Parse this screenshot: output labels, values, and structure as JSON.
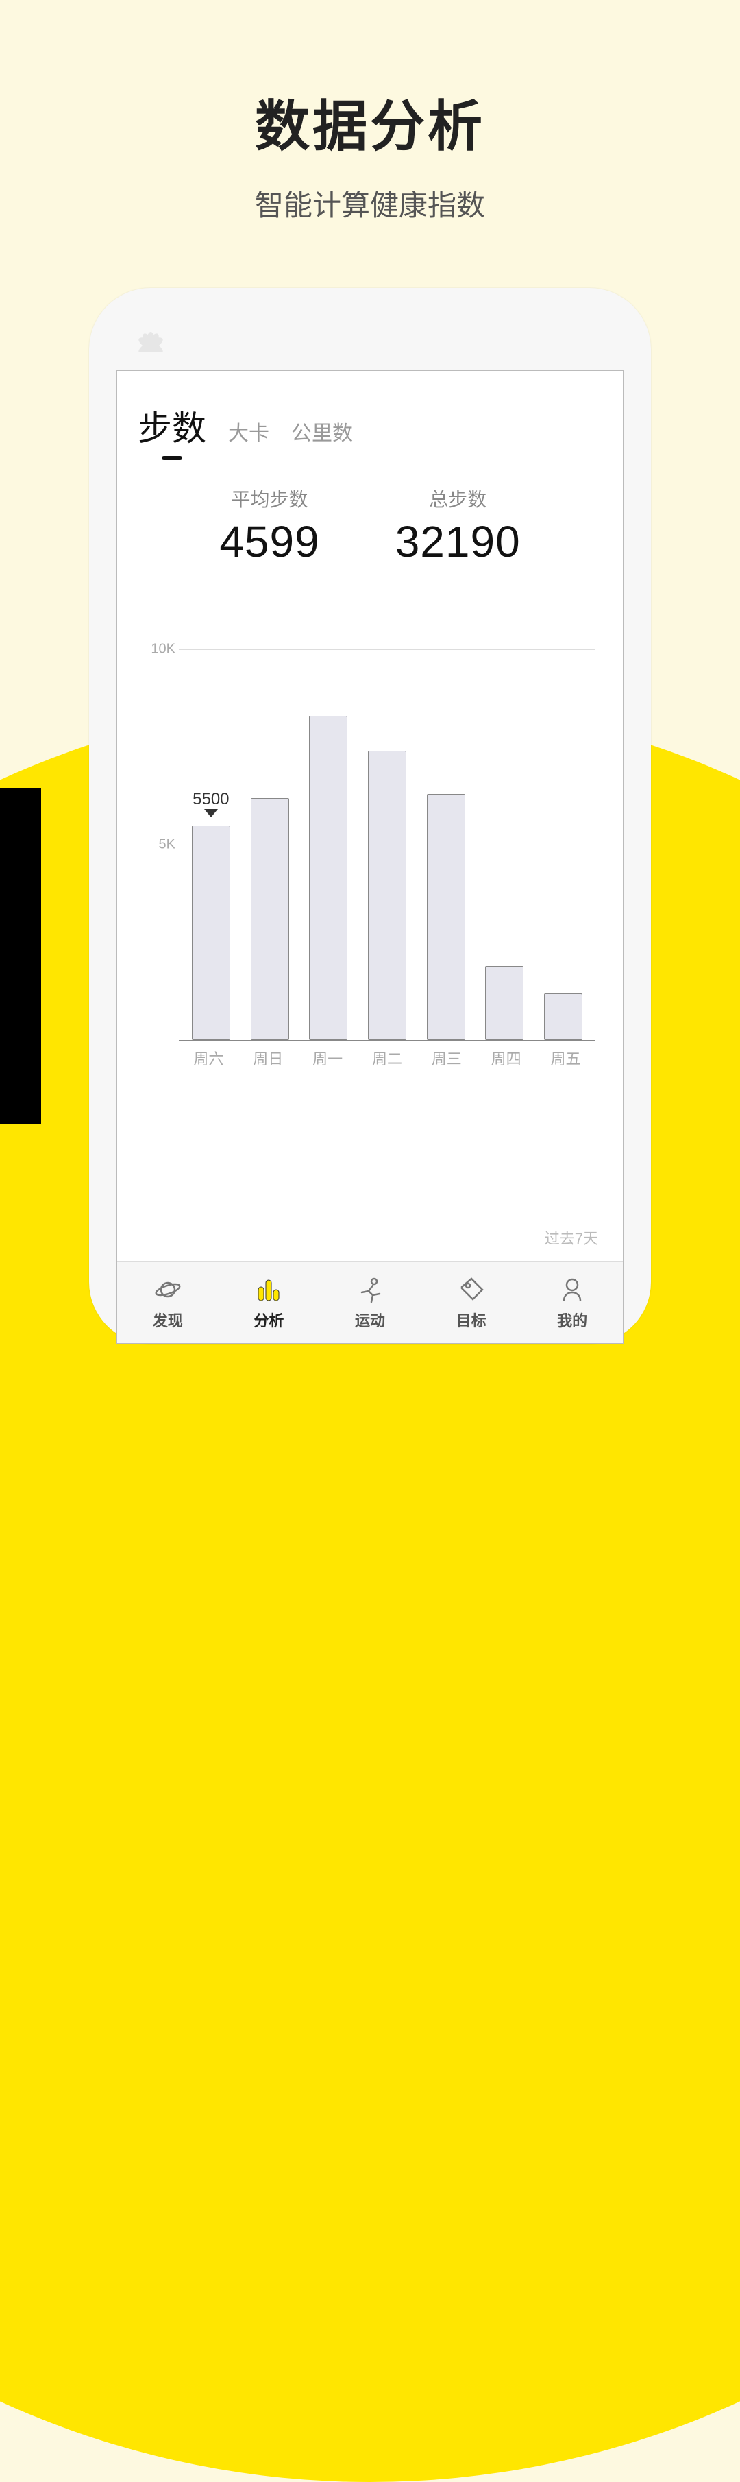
{
  "hero": {
    "title": "数据分析",
    "subtitle": "智能计算健康指数"
  },
  "tabs": [
    {
      "label": "步数",
      "active": true
    },
    {
      "label": "大卡",
      "active": false
    },
    {
      "label": "公里数",
      "active": false
    }
  ],
  "stats": {
    "avg": {
      "label": "平均步数",
      "value": "4599"
    },
    "total": {
      "label": "总步数",
      "value": "32190"
    }
  },
  "chart_data": {
    "type": "bar",
    "categories": [
      "周六",
      "周日",
      "周一",
      "周二",
      "周三",
      "周四",
      "周五"
    ],
    "values": [
      5500,
      6200,
      8300,
      7400,
      6300,
      1900,
      1200
    ],
    "y_ticks": [
      5000,
      10000
    ],
    "y_tick_labels": [
      "5K",
      "10K"
    ],
    "ylim": [
      0,
      10000
    ],
    "callout": {
      "index": 0,
      "text": "5500"
    },
    "caption": "过去7天"
  },
  "nav": [
    {
      "label": "发现",
      "icon": "planet-icon"
    },
    {
      "label": "分析",
      "icon": "bars-icon",
      "active": true
    },
    {
      "label": "运动",
      "icon": "runner-icon"
    },
    {
      "label": "目标",
      "icon": "tag-icon"
    },
    {
      "label": "我的",
      "icon": "person-icon"
    }
  ]
}
